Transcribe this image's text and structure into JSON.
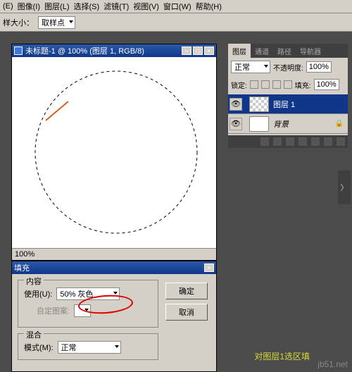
{
  "menu": {
    "items": [
      "(E)",
      "图像(I)",
      "图层(L)",
      "选择(S)",
      "滤镜(T)",
      "视图(V)",
      "窗口(W)",
      "帮助(H)"
    ]
  },
  "optbar": {
    "label": "样大小：",
    "select": "取样点"
  },
  "doc": {
    "title": "未标题-1 @ 100% (图层 1, RGB/8)",
    "zoom": "100%"
  },
  "fill": {
    "title": "填充",
    "group_content": "内容",
    "use_label": "使用(U):",
    "use_value": "50% 灰色",
    "custom": "自定图案:",
    "group_blend": "混合",
    "mode_label": "模式(M):",
    "mode_value": "正常",
    "ok": "确定",
    "cancel": "取消"
  },
  "panel": {
    "tabs": [
      "图层",
      "通道",
      "路径",
      "导航器"
    ],
    "blend": "正常",
    "opacity_label": "不透明度:",
    "opacity": "100%",
    "lock_label": "锁定:",
    "fill_label": "填充:",
    "fill": "100%",
    "layers": [
      {
        "name": "图层 1"
      },
      {
        "name": "背景"
      }
    ]
  },
  "annotation": "对图层1选区填",
  "watermark": "jb51.net"
}
